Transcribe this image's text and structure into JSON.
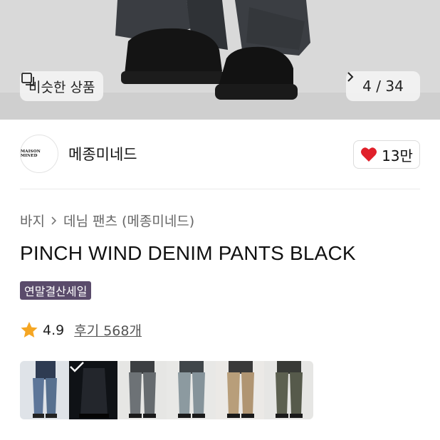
{
  "hero": {
    "similar_label": "비슷한 상품",
    "counter": "4 / 34"
  },
  "brand": {
    "logo_text": "MAISON MINED",
    "name": "메종미네드",
    "likes": "13만"
  },
  "breadcrumb": {
    "items": [
      "바지",
      "데님 팬츠 (메종미네드)"
    ]
  },
  "product": {
    "title": "PINCH WIND DENIM PANTS BLACK",
    "badge": "연말결산세일",
    "rating": "4.9",
    "reviews": "후기 568개"
  },
  "thumbnails": {
    "selected_index": 1,
    "items": [
      "blue-denim",
      "black-denim-night",
      "grey-denim",
      "light-grey-denim",
      "beige-pants",
      "olive-denim"
    ]
  },
  "colors": {
    "badge_bg": "#5a4b6b",
    "heart": "#e0202a",
    "star": "#f5a623"
  }
}
